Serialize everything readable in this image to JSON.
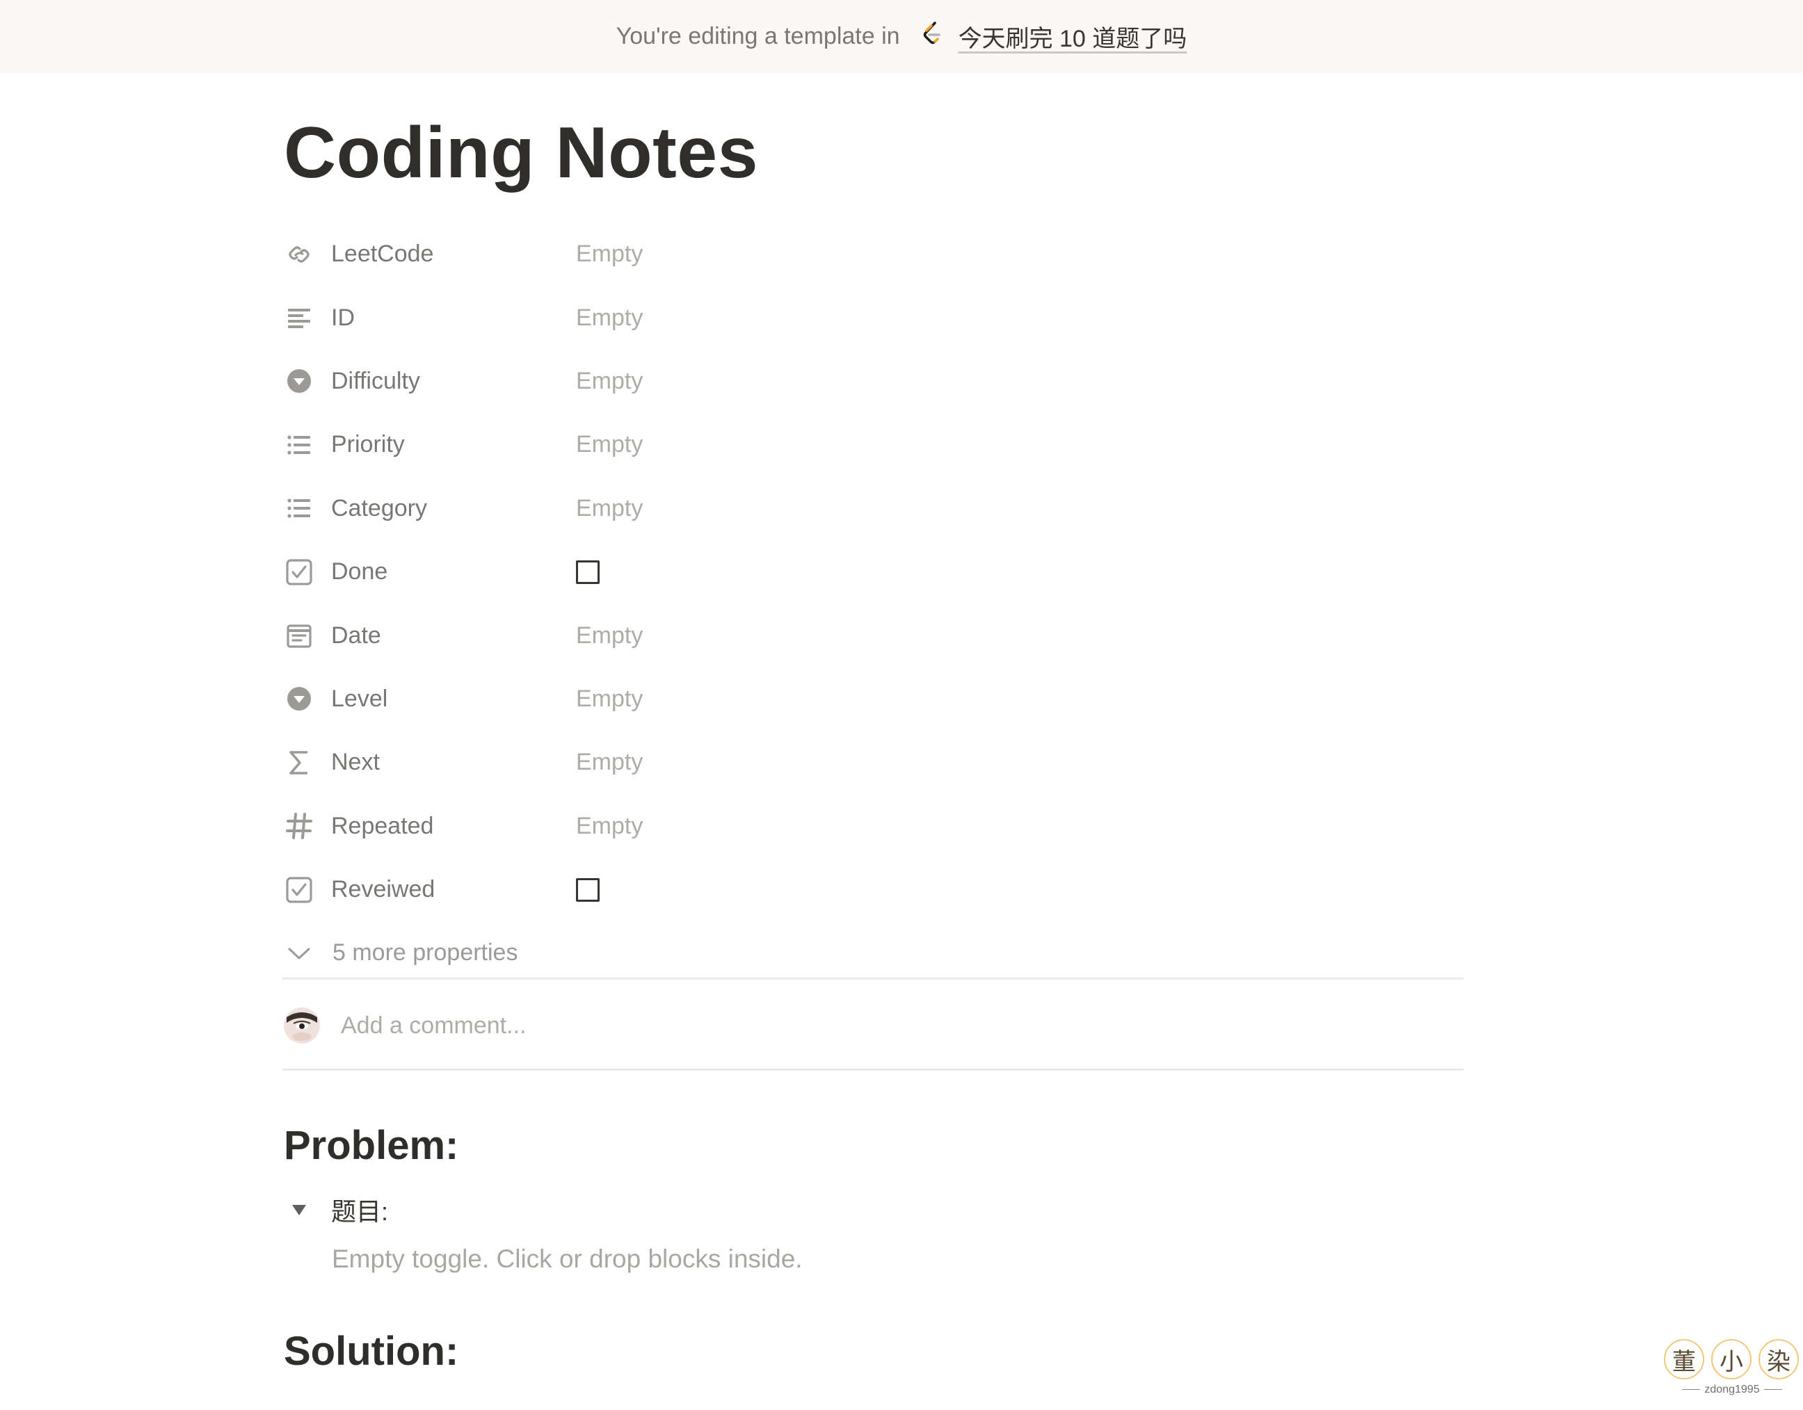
{
  "banner": {
    "prefix": "You're editing a template in",
    "database_icon": "leetcode-logo-icon",
    "database_name": "今天刷完 10 道题了吗"
  },
  "page": {
    "title": "Coding Notes"
  },
  "properties": [
    {
      "icon": "link-icon",
      "label": "LeetCode",
      "value": "Empty",
      "type": "url"
    },
    {
      "icon": "text-lines-icon",
      "label": "ID",
      "value": "Empty",
      "type": "text"
    },
    {
      "icon": "select-icon",
      "label": "Difficulty",
      "value": "Empty",
      "type": "select"
    },
    {
      "icon": "multi-select-icon",
      "label": "Priority",
      "value": "Empty",
      "type": "multi_select"
    },
    {
      "icon": "multi-select-icon",
      "label": "Category",
      "value": "Empty",
      "type": "multi_select"
    },
    {
      "icon": "checkbox-icon",
      "label": "Done",
      "value": "",
      "type": "checkbox",
      "checked": false
    },
    {
      "icon": "calendar-icon",
      "label": "Date",
      "value": "Empty",
      "type": "date"
    },
    {
      "icon": "select-icon",
      "label": "Level",
      "value": "Empty",
      "type": "select"
    },
    {
      "icon": "sigma-icon",
      "label": "Next",
      "value": "Empty",
      "type": "formula"
    },
    {
      "icon": "hash-icon",
      "label": "Repeated",
      "value": "Empty",
      "type": "number"
    },
    {
      "icon": "checkbox-icon",
      "label": "Reveiwed",
      "value": "",
      "type": "checkbox",
      "checked": false
    }
  ],
  "more_properties": {
    "label": "5 more properties",
    "icon": "chevron-down-icon"
  },
  "comment": {
    "placeholder": "Add a comment..."
  },
  "content": {
    "problem_heading": "Problem:",
    "toggle_label": "题目:",
    "toggle_empty": "Empty toggle. Click or drop blocks inside.",
    "solution_heading": "Solution:"
  },
  "watermark": {
    "chars": [
      "董",
      "小",
      "染"
    ],
    "caption": "zdong1995"
  },
  "colors": {
    "banner_bg": "#fbf9f5",
    "text_primary": "#37352f",
    "text_muted": "#787774",
    "placeholder": "#aeaca6",
    "divider": "#ebeae6",
    "leetcode_orange": "#f89f1b"
  }
}
